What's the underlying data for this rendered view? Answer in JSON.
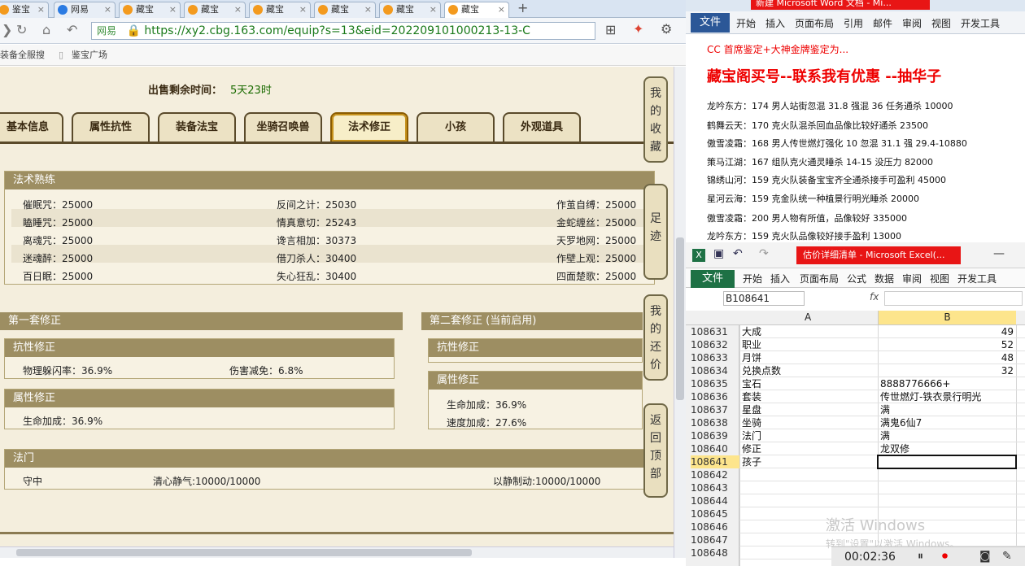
{
  "browser": {
    "tabs": [
      {
        "label": "鉴宝",
        "active": false
      },
      {
        "label": "网易",
        "active": false
      },
      {
        "label": "藏宝",
        "active": false
      },
      {
        "label": "藏宝",
        "active": false
      },
      {
        "label": "藏宝",
        "active": false
      },
      {
        "label": "藏宝",
        "active": false
      },
      {
        "label": "藏宝",
        "active": false
      },
      {
        "label": "藏宝",
        "active": true
      }
    ],
    "new_tab": "+",
    "address_prefix": "网易",
    "url": "https://xy2.cbg.163.com/equip?s=13&eid=202209101000213-13-C",
    "bookmarks": [
      "装备全服搜",
      "鉴宝广场"
    ],
    "sale": {
      "label": "出售剩余时间：",
      "value": "5天23时"
    },
    "game_tabs": [
      "基本信息",
      "属性抗性",
      "装备法宝",
      "坐骑召唤兽",
      "法术修正",
      "小孩",
      "外观道具"
    ],
    "selected_tab": "法术修正",
    "skills_section": {
      "title": "法术熟练",
      "rows": [
        [
          "催眠咒：25000",
          "反间之计：25030",
          "作茧自缚：25000"
        ],
        [
          "瞌睡咒：25000",
          "情真意切：25243",
          "金蛇缠丝：25000"
        ],
        [
          "离魂咒：25000",
          "谗言相加：30373",
          "天罗地网：25000"
        ],
        [
          "迷魂醉：25000",
          "借刀杀人：30400",
          "作壁上观：25000"
        ],
        [
          "百日眠：25000",
          "失心狂乱：30400",
          "四面楚歌：25000"
        ]
      ]
    },
    "set1": {
      "title": "第一套修正",
      "resist": {
        "title": "抗性修正",
        "items": [
          "物理躲闪率：36.9%",
          "伤害减免：6.8%"
        ]
      },
      "attr": {
        "title": "属性修正",
        "items": [
          "生命加成：36.9%"
        ]
      }
    },
    "set2": {
      "title": "第二套修正 (当前启用)",
      "resist": {
        "title": "抗性修正"
      },
      "attr": {
        "title": "属性修正",
        "items": [
          "生命加成：36.9%",
          "速度加成：27.6%"
        ]
      }
    },
    "famen": {
      "title": "法门",
      "items": [
        "守中",
        "清心静气:10000/10000",
        "以静制动:10000/10000"
      ]
    },
    "side_buttons": [
      [
        "我",
        "的",
        "收",
        "藏"
      ],
      [
        "足",
        "迹"
      ],
      [
        "我",
        "的",
        "还",
        "价"
      ],
      [
        "返",
        "回",
        "顶",
        "部"
      ]
    ]
  },
  "word": {
    "title": "新建 Microsoft Word 文档 - Mi...",
    "ribbon_tabs": [
      "文件",
      "开始",
      "插入",
      "页面布局",
      "引用",
      "邮件",
      "审阅",
      "视图",
      "开发工具"
    ],
    "header_line": "CC 首席鉴定+大神金牌鉴定为...",
    "headline": "藏宝阁买号--联系我有优惠 --抽华子",
    "lines": [
      "龙吟东方：174 男人站街忽混 31.8 强混 36 任务通杀 10000",
      "鹤舞云天：170 克火队混杀回血品像比较好通杀 23500",
      "傲雪凌霜：168 男人传世燃灯强化 10 忽混 31.1 强 29.4-10880",
      "策马江湖：167 组队克火通灵睡杀 14-15 没压力 82000",
      "锦绣山河：159 克火队装备宝宝齐全通杀接手可盈利 45000",
      "星河云海：159 克金队统一种植景行明光睡杀 20000",
      "傲雪凌霜：200 男人物有所值，品像较好 335000",
      "龙吟东方：159 克火队品像较好接手盈利 13000"
    ]
  },
  "excel": {
    "title": "估价详细清单 - Microsoft Excel(...",
    "ribbon_tabs": [
      "文件",
      "开始",
      "插入",
      "页面布局",
      "公式",
      "数据",
      "审阅",
      "视图",
      "开发工具"
    ],
    "name_box": "B108641",
    "fx": "fx",
    "col_a": "A",
    "col_b": "B",
    "rows": [
      {
        "n": "108631",
        "a": "大成",
        "b": "49",
        "num": true
      },
      {
        "n": "108632",
        "a": "职业",
        "b": "52",
        "num": true
      },
      {
        "n": "108633",
        "a": "月饼",
        "b": "48",
        "num": true
      },
      {
        "n": "108634",
        "a": "兑换点数",
        "b": "32",
        "num": true
      },
      {
        "n": "108635",
        "a": "宝石",
        "b": "8888776666+",
        "num": false
      },
      {
        "n": "108636",
        "a": "套装",
        "b": "传世燃灯-铁衣景行明光",
        "num": false
      },
      {
        "n": "108637",
        "a": "星盘",
        "b": "满",
        "num": false
      },
      {
        "n": "108638",
        "a": "坐骑",
        "b": "满鬼6仙7",
        "num": false
      },
      {
        "n": "108639",
        "a": "法门",
        "b": "满",
        "num": false
      },
      {
        "n": "108640",
        "a": "修正",
        "b": "龙双修",
        "num": false
      },
      {
        "n": "108641",
        "a": "孩子",
        "b": "",
        "num": false
      },
      {
        "n": "108642",
        "a": "",
        "b": "",
        "num": false
      },
      {
        "n": "108643",
        "a": "",
        "b": "",
        "num": false
      },
      {
        "n": "108644",
        "a": "",
        "b": "",
        "num": false
      },
      {
        "n": "108645",
        "a": "",
        "b": "",
        "num": false
      },
      {
        "n": "108646",
        "a": "",
        "b": "",
        "num": false
      },
      {
        "n": "108647",
        "a": "",
        "b": "",
        "num": false
      },
      {
        "n": "108648",
        "a": "",
        "b": "",
        "num": false
      }
    ],
    "watermark_1": "激活 Windows",
    "watermark_2": "转到\"设置\"以激活 Windows。"
  },
  "recorder": {
    "time": "00:02:36"
  }
}
